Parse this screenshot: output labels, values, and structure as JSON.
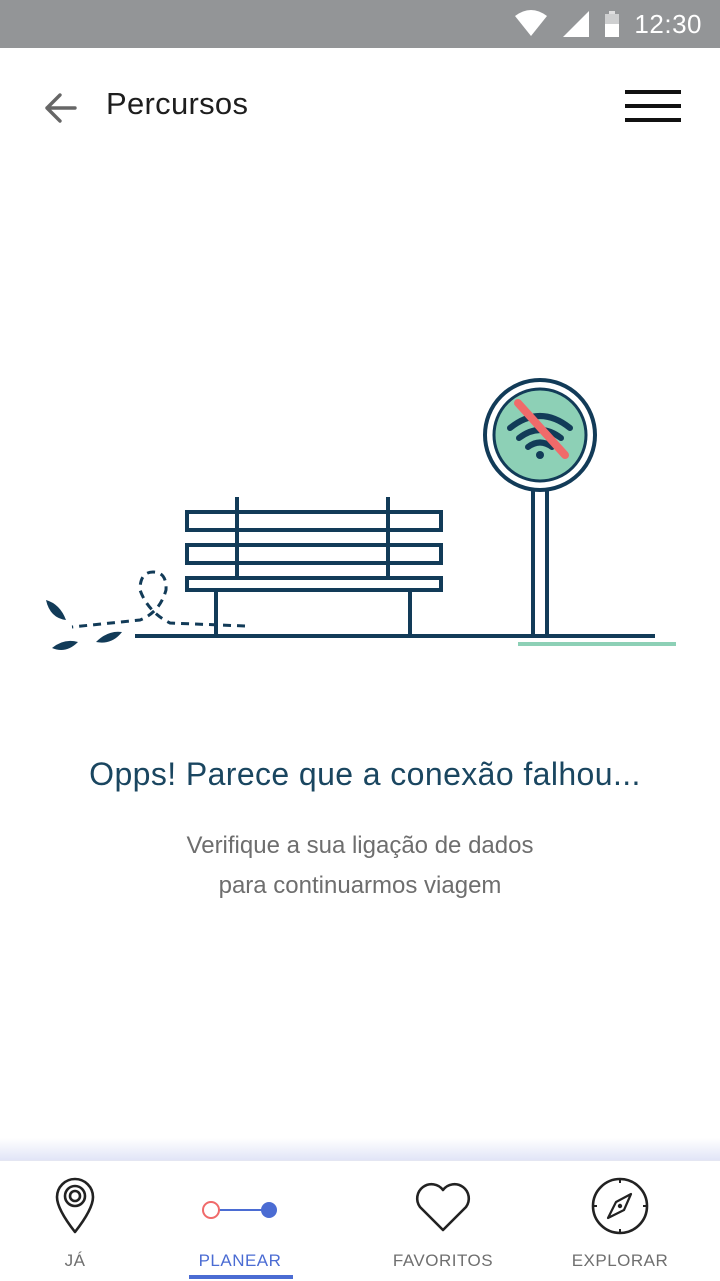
{
  "status_bar": {
    "time": "12:30",
    "icons": [
      "wifi-icon",
      "signal-icon",
      "battery-icon"
    ]
  },
  "header": {
    "title": "Percursos",
    "back_icon": "arrow-left-icon",
    "menu_icon": "hamburger-menu-icon"
  },
  "illustration": {
    "icons": [
      "bench-icon",
      "no-wifi-sign-icon",
      "leaves-icon"
    ]
  },
  "message": {
    "title": "Opps! Parece que a conexão falhou...",
    "line1": "Verifique a sua ligação de dados",
    "line2": "para continuarmos viagem"
  },
  "bottom_nav": {
    "active": "planear",
    "items": [
      {
        "label": "JÁ",
        "icon": "location-pin-icon"
      },
      {
        "label": "PLANEAR",
        "icon": "route-icon"
      },
      {
        "label": "FAVORITOS",
        "icon": "heart-icon"
      },
      {
        "label": "EXPLORAR",
        "icon": "compass-icon"
      }
    ]
  },
  "colors": {
    "status_bar": "#939597",
    "accent": "#4b6cd3",
    "illustration_dark": "#123b58",
    "sign_fill": "#8dd0b6",
    "strike": "#f06a6a",
    "error_title": "#1a4660"
  }
}
